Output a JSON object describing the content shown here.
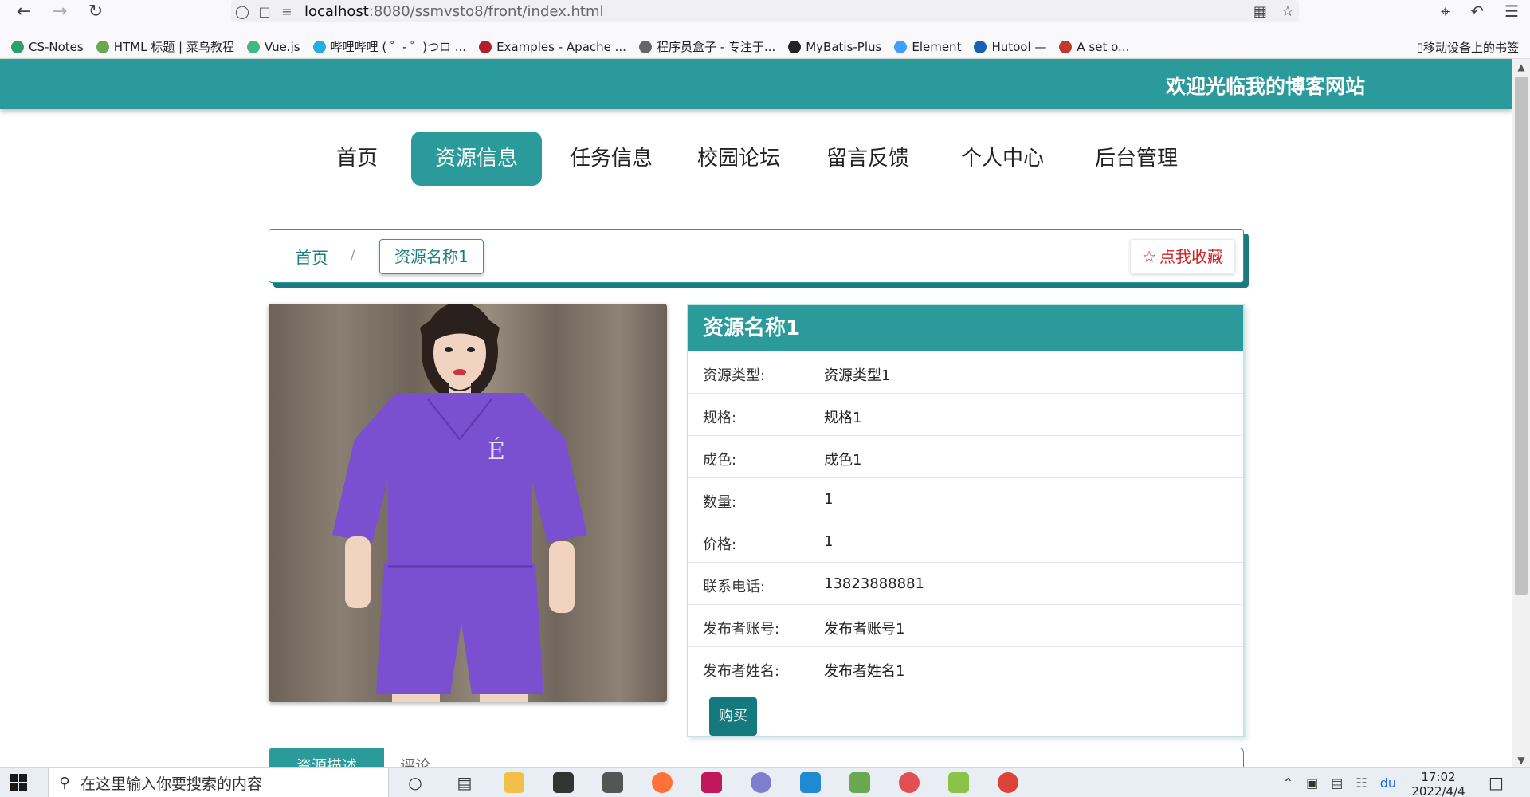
{
  "browser": {
    "url_host": "localhost",
    "url_path": ":8080/ssmvsto8/front/index.html",
    "bookmarks": [
      {
        "label": "CS-Notes",
        "color": "#2e9e6e"
      },
      {
        "label": "HTML 标题 | 菜鸟教程",
        "color": "#6aa84f"
      },
      {
        "label": "Vue.js",
        "color": "#41b883"
      },
      {
        "label": "哔哩哔哩 ( ゜- ゜)つロ ...",
        "color": "#23ade5"
      },
      {
        "label": "Examples - Apache ...",
        "color": "#b0202f"
      },
      {
        "label": "程序员盒子 - 专注于...",
        "color": "#666666"
      },
      {
        "label": "MyBatis-Plus",
        "color": "#222222"
      },
      {
        "label": "Element",
        "color": "#409eff"
      },
      {
        "label": "Hutool — ",
        "color": "#1a5fb4"
      },
      {
        "label": "A set o...",
        "color": "#c0392b"
      }
    ],
    "mobile_bookmarks": "移动设备上的书签"
  },
  "header": {
    "welcome": "欢迎光临我的博客网站",
    "accent_color": "#2a9a9a"
  },
  "nav": [
    {
      "label": "首页",
      "active": false
    },
    {
      "label": "资源信息",
      "active": true
    },
    {
      "label": "任务信息",
      "active": false
    },
    {
      "label": "校园论坛",
      "active": false
    },
    {
      "label": "留言反馈",
      "active": false
    },
    {
      "label": "个人中心",
      "active": false
    },
    {
      "label": "后台管理",
      "active": false
    }
  ],
  "breadcrumb": {
    "home": "首页",
    "separator": "/",
    "current": "资源名称1",
    "favorite": "点我收藏"
  },
  "detail": {
    "title": "资源名称1",
    "rows": [
      {
        "label": "资源类型:",
        "value": "资源类型1"
      },
      {
        "label": "规格:",
        "value": "规格1"
      },
      {
        "label": "成色:",
        "value": "成色1"
      },
      {
        "label": "数量:",
        "value": "1"
      },
      {
        "label": "价格:",
        "value": "1"
      },
      {
        "label": "联系电话:",
        "value": "13823888881"
      },
      {
        "label": "发布者账号:",
        "value": "发布者账号1"
      },
      {
        "label": "发布者姓名:",
        "value": "发布者姓名1"
      }
    ],
    "buy": "购买"
  },
  "tabs": [
    {
      "label": "资源描述",
      "active": true
    },
    {
      "label": "评论",
      "active": false
    }
  ],
  "taskbar": {
    "search_placeholder": "在这里输入你要搜索的内容",
    "time": "17:02",
    "date": "2022/4/4"
  }
}
